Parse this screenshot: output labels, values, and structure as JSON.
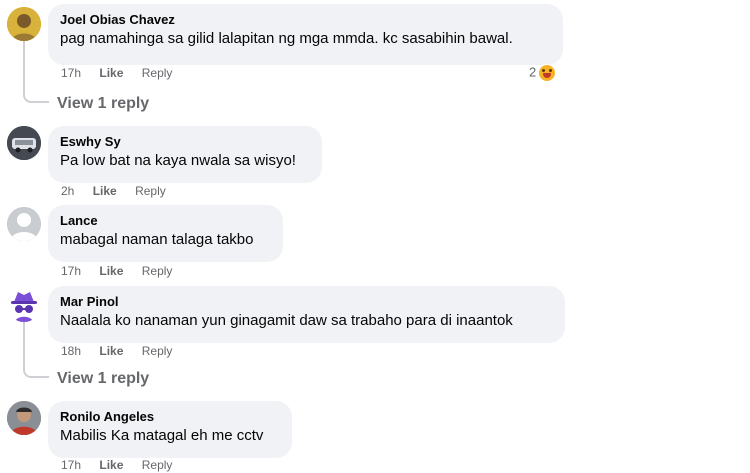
{
  "comments": [
    {
      "name": "Joel Obias Chavez",
      "text": "pag namahinga sa gilid lalapitan ng mga mmda. kc sasabihin bawal.",
      "time": "17h",
      "like": "Like",
      "reply": "Reply",
      "reaction_count": "2",
      "view_replies": "View 1 reply"
    },
    {
      "name": "Eswhy Sy",
      "text": "Pa low bat na kaya nwala sa wisyo!",
      "time": "2h",
      "like": "Like",
      "reply": "Reply"
    },
    {
      "name": "Lance",
      "text": "mabagal naman talaga takbo",
      "time": "17h",
      "like": "Like",
      "reply": "Reply"
    },
    {
      "name": "Mar Pinol",
      "text": "Naalala ko nanaman yun ginagamit daw sa trabaho para di inaantok",
      "time": "18h",
      "like": "Like",
      "reply": "Reply",
      "view_replies": "View 1 reply"
    },
    {
      "name": "Ronilo Angeles",
      "text": "Mabilis Ka matagal eh me cctv",
      "time": "17h",
      "like": "Like",
      "reply": "Reply"
    }
  ]
}
